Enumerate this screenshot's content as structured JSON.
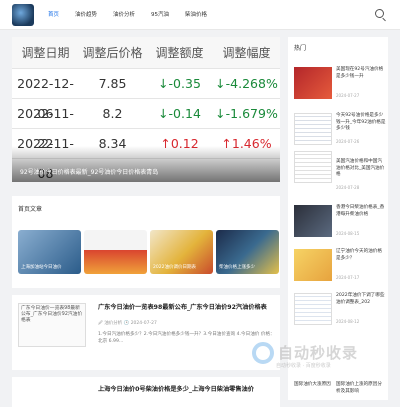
{
  "nav": {
    "items": [
      "首页",
      "油价趋势",
      "油价分析",
      "95汽油",
      "柴油价格"
    ]
  },
  "hero": {
    "headers": [
      "调整日期",
      "调整后价格",
      "调整额度",
      "调整幅度"
    ],
    "rows": [
      {
        "date": "2022-12-06",
        "price": "7.85",
        "amount": "↓-0.35",
        "percent": "↓-4.268%"
      },
      {
        "date": "2022-11-22",
        "price": "8.2",
        "amount": "↓-0.14",
        "percent": "↓-1.679%"
      },
      {
        "date": "2022-11-08",
        "price": "8.34",
        "amount": "↑0.12",
        "percent": "↑1.46%"
      }
    ],
    "caption": "92号油价今日价格表最新_92号油价今日价格表青岛"
  },
  "recommend": {
    "title": "首页文章",
    "thumbs": [
      "上海加油站今日油价",
      "",
      "2022油价调价日期表",
      "柴油价格上涨多少"
    ]
  },
  "articles": [
    {
      "thumb_text": "广东今日油价一览表98最新公布_广东今日油价92汽油价格表",
      "title": "广东今日油价一览表98最新公布_广东今日油价92汽油价格表",
      "meta": "🖉 油价分析   🕓 2024-07-27",
      "body": "1.今日汽油价格多少？2.今日汽油价格多少钱一升？3.今日油价查询 4.今日油价  价格：北京 6.99..."
    },
    {
      "title": "上海今日油价0号柴油价格是多少_上海今日柴油零售油价"
    }
  ],
  "sidebar": {
    "title": "热门",
    "items": [
      {
        "text": "美国现在92号汽油价格是多少钱一升",
        "date": "2024-07-27"
      },
      {
        "text": "今天92号油价格是多少钱一升_今年92油价格是多少钱",
        "date": "2024-07-26"
      },
      {
        "text": "今天92号油价多少钱一升_今年92油价格...",
        "date": ""
      },
      {
        "text": "美国汽油价格和中国汽油价格对比_美国汽油价格",
        "date": "2024-07-28"
      },
      {
        "text": "香港今日柴油价格表_香港每升柴油价格",
        "date": "2024-08-15"
      },
      {
        "text": "辽宁油价今天的油价格是多少？",
        "date": "2024-07-17"
      },
      {
        "text": "2022年油价下调了哪些油价调整表_202",
        "date": "2024-08-12"
      }
    ],
    "footer_items": [
      "国际油价大涨原因",
      "国际油价上涨的原因分析及其影响"
    ]
  },
  "watermark": {
    "text": "自动秒收录",
    "sub": "自动秒收录 · 百度秒收录"
  },
  "colors": {
    "accent": "#1e73e8",
    "down": "#1a8a3a",
    "up": "#d8282f"
  }
}
